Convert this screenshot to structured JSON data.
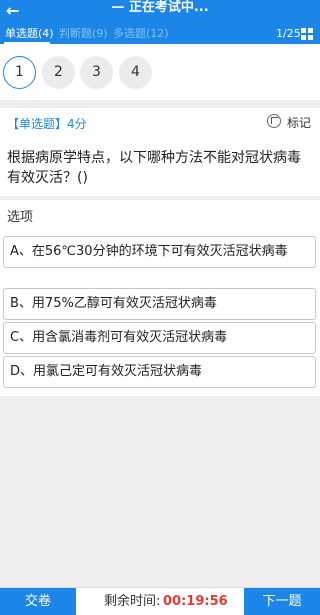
{
  "header": {
    "back_symbol": "←",
    "title": "— 正在考试中...",
    "tabs": [
      {
        "label": "单选题(4)"
      },
      {
        "label": "判断题(9)"
      },
      {
        "label": "多选题(12)"
      }
    ],
    "pager": "1/25"
  },
  "question_numbers": [
    "1",
    "2",
    "3",
    "4"
  ],
  "question": {
    "type_label": "【单选题】4分",
    "mark_label": "标记",
    "text": "根据病原学特点，以下哪种方法不能对冠状病毒有效灭活？()"
  },
  "options_section": {
    "heading": "选项",
    "options": [
      {
        "text": "A、在56℃30分钟的环境下可有效灭活冠状病毒"
      },
      {
        "text": "B、用75%乙醇可有效灭活冠状病毒"
      },
      {
        "text": "C、用含氯消毒剂可有效灭活冠状病毒"
      },
      {
        "text": "D、用氯己定可有效灭活冠状病毒"
      }
    ]
  },
  "footer": {
    "submit_label": "交卷",
    "time_label": "剩余时间:",
    "time_value": "00:19:56",
    "next_label": "下一题"
  }
}
